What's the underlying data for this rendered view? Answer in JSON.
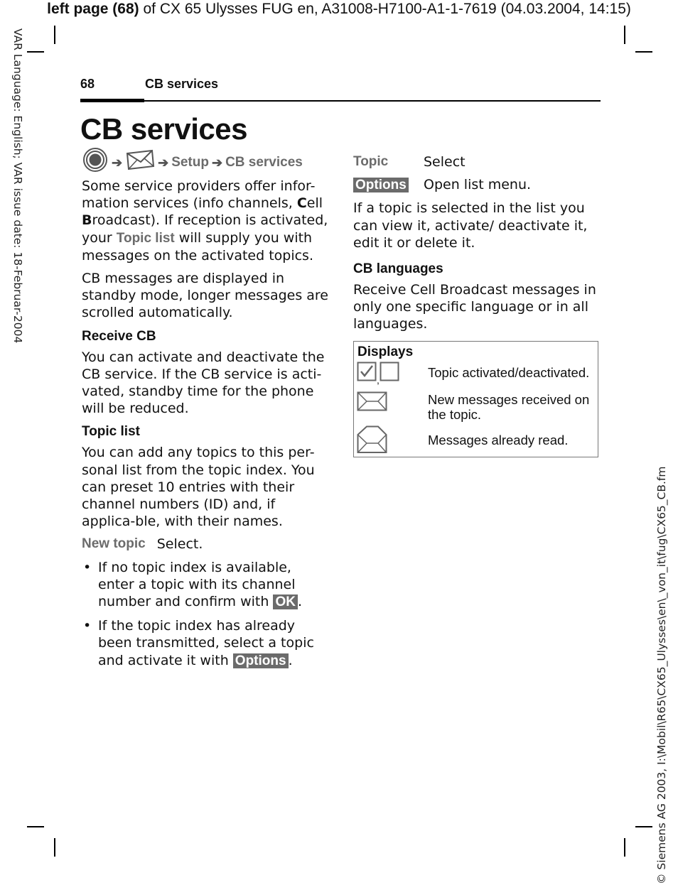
{
  "banner": {
    "bold": "left page (68)",
    "rest": " of CX 65 Ulysses FUG en, A31008-H7100-A1-1-7619 (04.03.2004, 14:15)"
  },
  "margin_left": "VAR Language: English; VAR issue date: 18-Februar-2004",
  "margin_right": "© Siemens AG 2003, I:\\Mobil\\R65\\CX65_Ulysses\\en\\_von_it\\fug\\CX65_CB.fm",
  "running_head": {
    "page_number": "68",
    "section": "CB services"
  },
  "title": "CB services",
  "menu_path": {
    "icons": [
      "navigation-key-icon",
      "envelope-icon"
    ],
    "steps": [
      "Setup",
      "CB services"
    ]
  },
  "intro": {
    "p1_a": "Some service providers offer infor-mation services (info channels, ",
    "p1_c": "C",
    "p1_b": "ell ",
    "p1_bb": "B",
    "p1_d": "roadcast). If reception is activated, your ",
    "p1_term": "Topic list",
    "p1_e": " will supply you with messages on the activated topics.",
    "p2": "CB messages are displayed in standby mode, longer messages are scrolled automatically."
  },
  "receive_cb": {
    "heading": "Receive CB",
    "text": "You can activate and deactivate the CB service. If the CB service is acti-vated, standby time for the phone will be reduced."
  },
  "topic_list": {
    "heading": "Topic list",
    "text": "You can add any topics to this per-sonal list from the topic index. You can preset 10 entries with their channel numbers (ID) and, if applica-ble, with their names.",
    "new_topic_term": "New topic",
    "new_topic_action": "Select.",
    "bullets": [
      {
        "text": "If no topic index is available, enter a topic with its channel number and confirm with ",
        "softkey": "OK",
        "end": "."
      },
      {
        "text": "If the topic index has already been transmitted, select a topic and activate it with ",
        "softkey": "Options",
        "end": "."
      }
    ],
    "bullet_char": "•"
  },
  "right_col": {
    "topic_term": "Topic",
    "topic_action": "Select",
    "options_softkey": "Options",
    "options_action": "Open list menu.",
    "topic_selected_text": "If a topic is selected in the list you can view it, activate/ deactivate it, edit it or delete it.",
    "cb_languages_heading": "CB languages",
    "cb_languages_text": "Receive Cell Broadcast messages in only one specific language or in all languages."
  },
  "displays": {
    "title": "Displays",
    "rows": [
      {
        "icons": [
          "checkbox-checked-icon",
          "checkbox-empty-icon"
        ],
        "separator": ",",
        "desc": "Topic activated/deactivated."
      },
      {
        "icons": [
          "envelope-closed-icon"
        ],
        "desc": "New messages received on the topic."
      },
      {
        "icons": [
          "envelope-open-icon"
        ],
        "desc": "Messages already read."
      }
    ]
  },
  "colors": {
    "menu_term": "#6b6b6b",
    "softkey_bg": "#6b6b6b",
    "softkey_text": "#ffffff",
    "text": "#111111",
    "box_border": "#777777"
  }
}
